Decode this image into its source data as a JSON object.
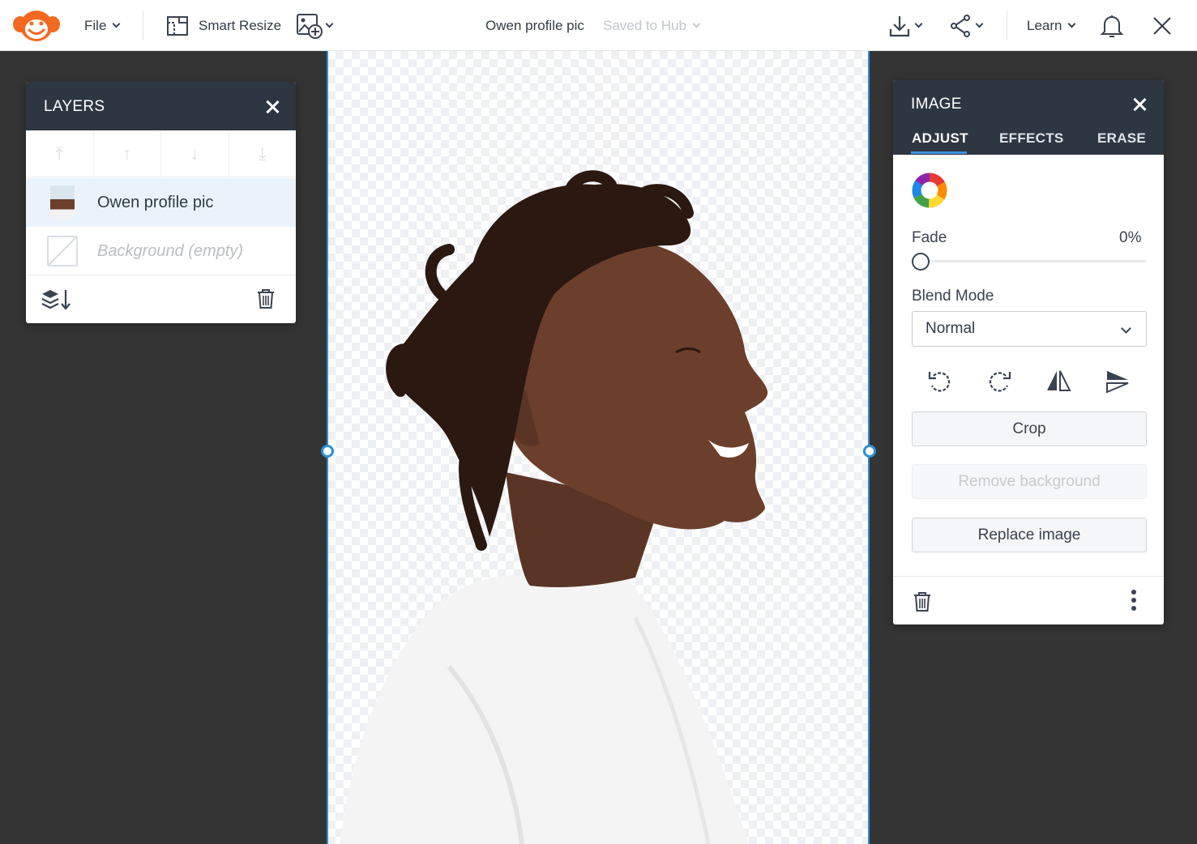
{
  "topbar": {
    "file_label": "File",
    "smart_resize_label": "Smart Resize",
    "doc_title": "Owen profile pic",
    "save_status": "Saved to Hub",
    "learn_label": "Learn"
  },
  "layers_panel": {
    "title": "LAYERS",
    "items": [
      {
        "name": "Owen profile pic",
        "selected": true
      },
      {
        "name": "Background (empty)",
        "selected": false
      }
    ]
  },
  "image_panel": {
    "title": "IMAGE",
    "tabs": [
      "ADJUST",
      "EFFECTS",
      "ERASE"
    ],
    "active_tab": "ADJUST",
    "fade_label": "Fade",
    "fade_value": "0%",
    "blend_label": "Blend Mode",
    "blend_value": "Normal",
    "crop_label": "Crop",
    "remove_bg_label": "Remove background",
    "replace_label": "Replace image"
  },
  "colors": {
    "brand_orange": "#f26a21",
    "panel_header": "#2e3642",
    "selection_blue": "#2d8fd5",
    "workspace_bg": "#343434"
  }
}
